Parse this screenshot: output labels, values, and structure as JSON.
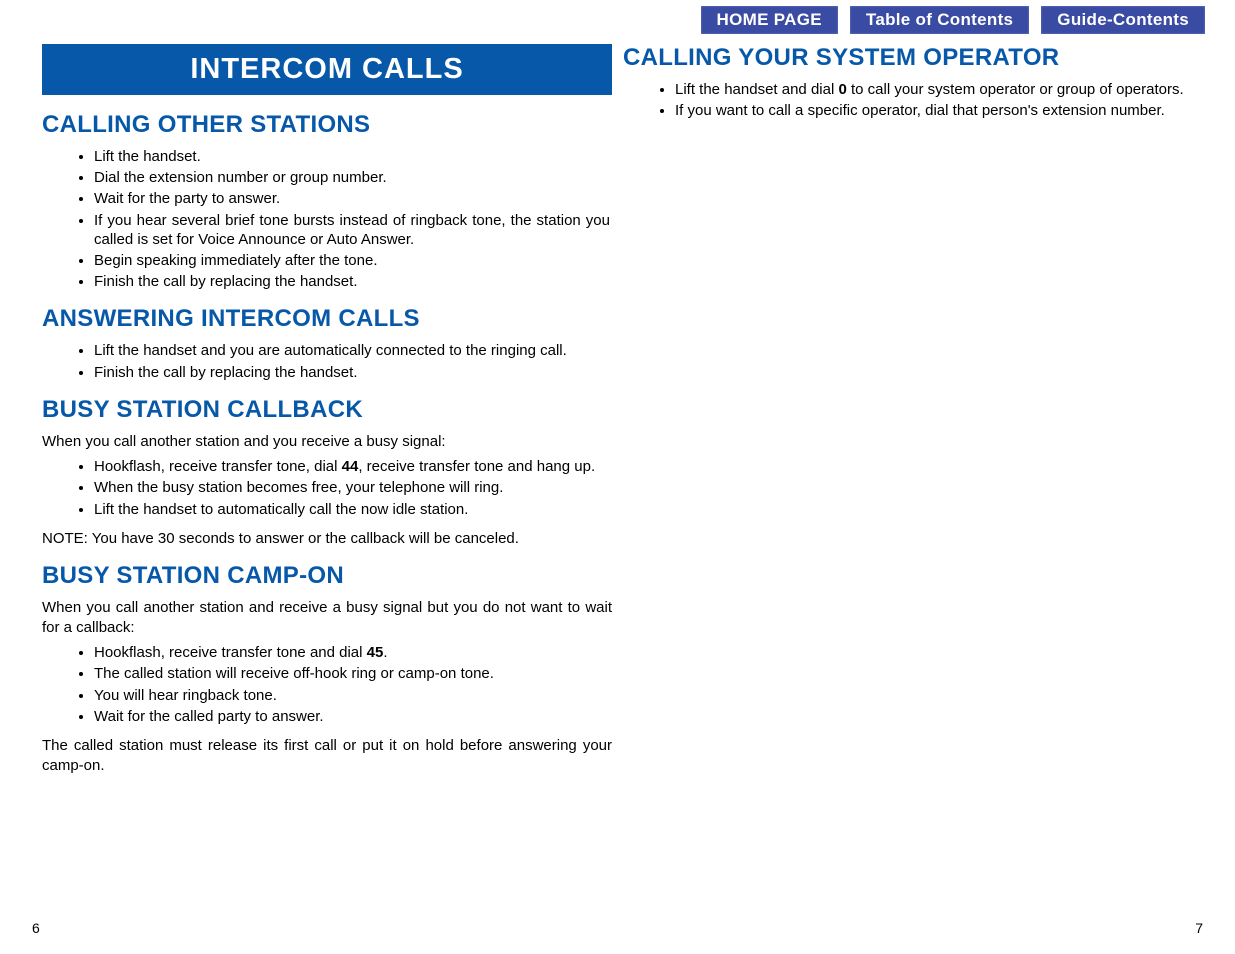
{
  "nav": {
    "home": "HOME PAGE",
    "toc": "Table of Contents",
    "guide": "Guide-Contents"
  },
  "left": {
    "banner": "INTERCOM CALLS",
    "s1": {
      "title": "CALLING OTHER STATIONS",
      "items": [
        "Lift the handset.",
        "Dial the extension number or group number.",
        "Wait for the party to answer.",
        "If you hear several brief tone bursts instead of ringback tone, the station you called is set for Voice Announce or Auto Answer.",
        "Begin speaking immediately after the tone.",
        "Finish the call by replacing the handset."
      ]
    },
    "s2": {
      "title": "ANSWERING INTERCOM CALLS",
      "items": [
        "Lift the handset and you are automatically connected to the ringing call.",
        "Finish the call by replacing the handset."
      ]
    },
    "s3": {
      "title": "BUSY STATION CALLBACK",
      "intro": "When you call another station and you receive a busy signal:",
      "item0_pre": "Hookflash, receive transfer tone, dial ",
      "item0_bold": "44",
      "item0_post": ", receive transfer tone and hang up.",
      "items_rest": [
        "When the busy station becomes free, your telephone will ring.",
        "Lift the handset to automatically call the now idle station."
      ],
      "note": "NOTE: You have 30 seconds to answer or the callback will be canceled."
    },
    "s4": {
      "title": "BUSY STATION CAMP-ON",
      "intro": "When you call another station and receive a busy signal but you do not want to wait for a callback:",
      "item0_pre": "Hookflash, receive transfer tone and dial ",
      "item0_bold": "45",
      "item0_post": ".",
      "items_rest": [
        "The called station will receive off-hook ring or camp-on tone.",
        "You will hear ringback tone.",
        "Wait for the called party to answer."
      ],
      "closing": "The called station must release its first call or put it on hold before answering your camp-on."
    },
    "page_num": "6"
  },
  "right": {
    "s1": {
      "title": "CALLING YOUR SYSTEM OPERATOR",
      "item0_pre": "Lift the handset and dial ",
      "item0_bold": "0",
      "item0_post": " to call your system operator or group of operators.",
      "items_rest": [
        "If you want to call a specific operator, dial that person's extension number."
      ]
    },
    "page_num": "7"
  }
}
